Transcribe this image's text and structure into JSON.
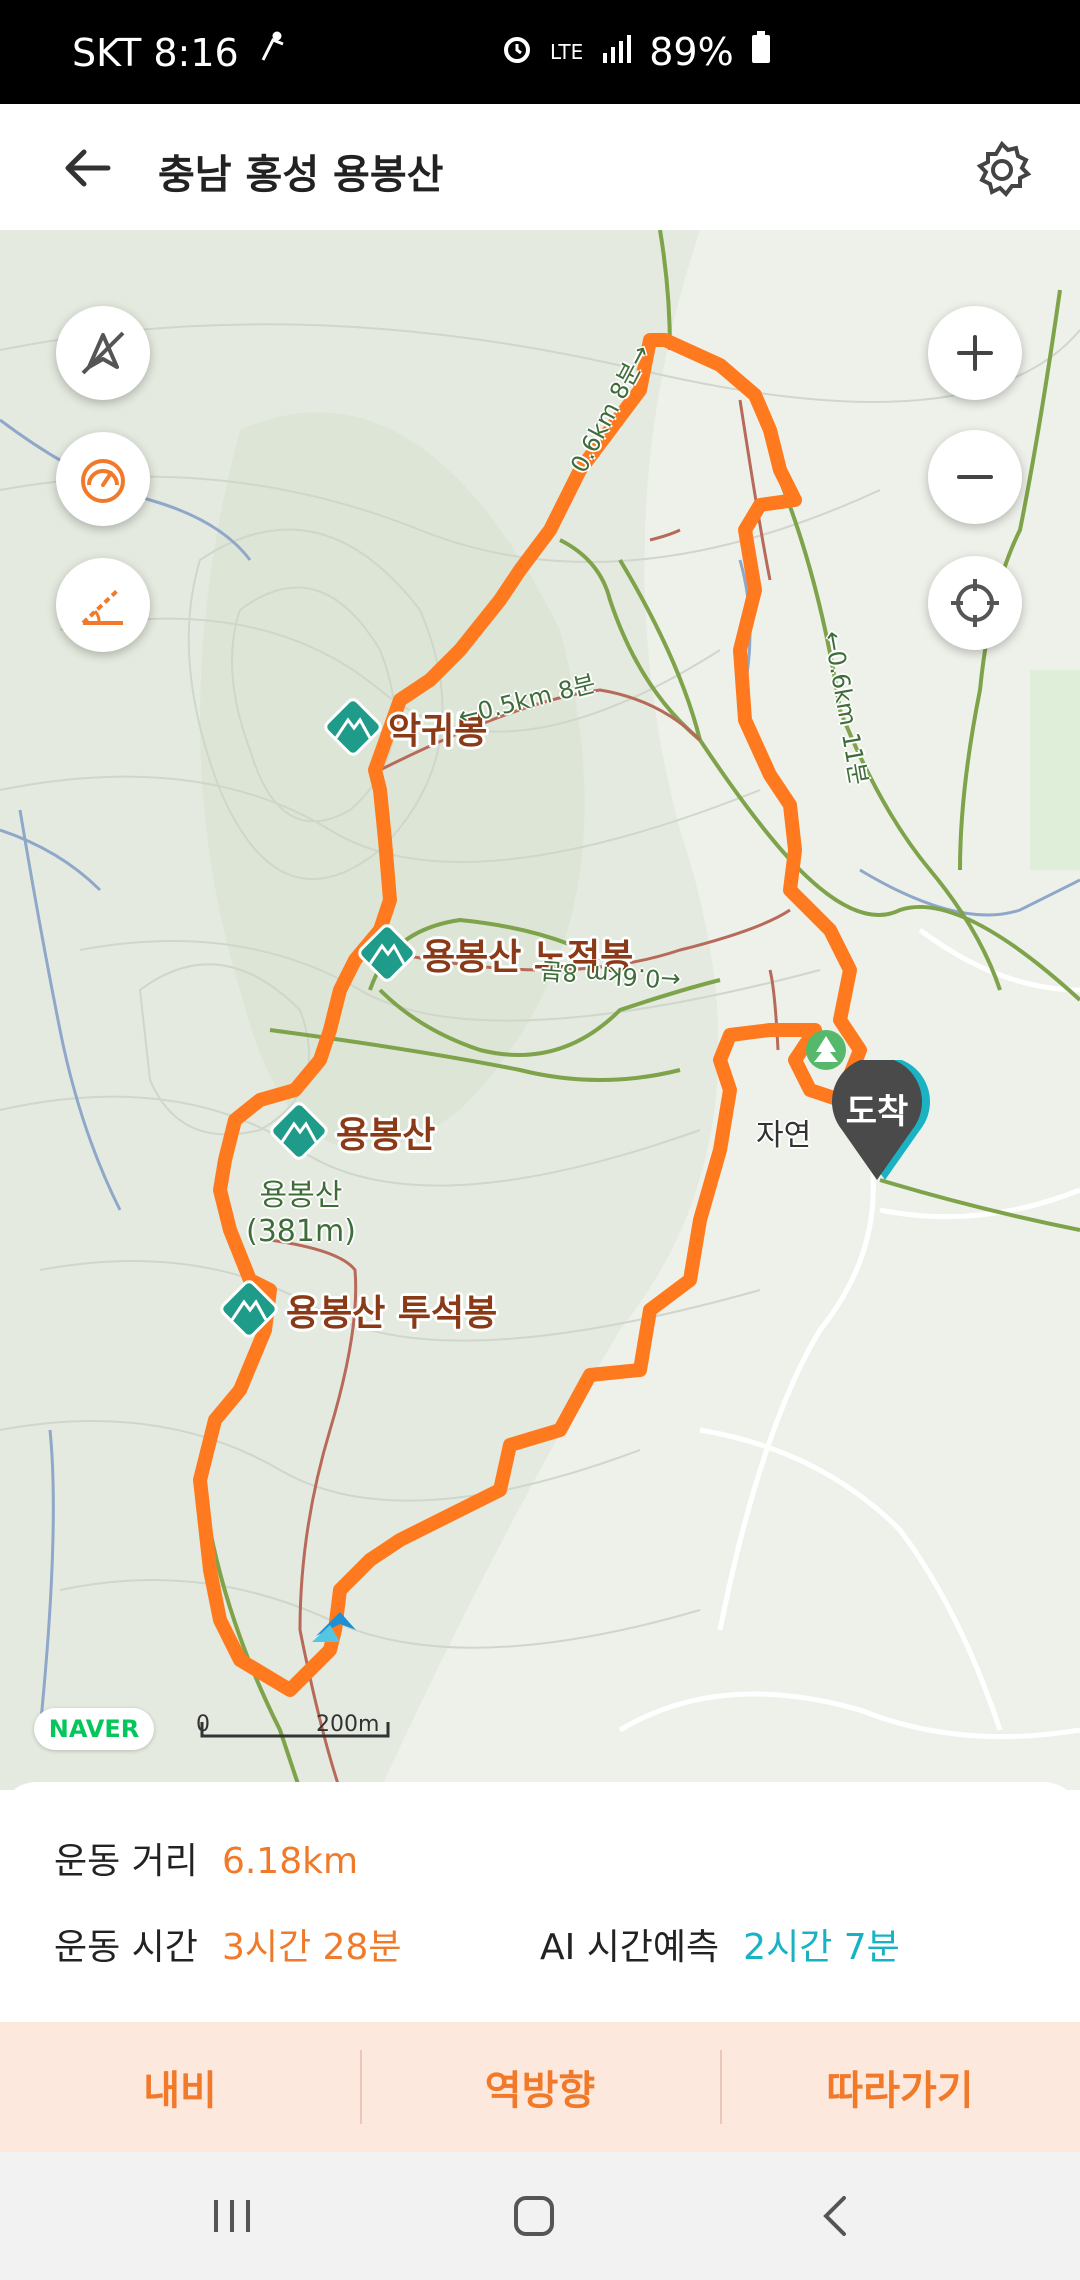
{
  "status": {
    "carrier_time": "SKT 8:16",
    "network": "LTE",
    "battery": "89%"
  },
  "header": {
    "title": "충남 홍성 용봉산"
  },
  "map": {
    "peaks": [
      {
        "name": "악귀봉"
      },
      {
        "name": "용봉산 노적봉"
      },
      {
        "name": "용봉산"
      },
      {
        "name": "용봉산 투석봉"
      }
    ],
    "peak_caption": "용봉산\n(381m)",
    "trail_notes": [
      "←0.5km 8분",
      "←0.6km 8분",
      "←0.6km 11분",
      "0.6km 8분→"
    ],
    "place_label": "자연",
    "end_marker": "도착",
    "naver": "NAVER",
    "scale_start": "0",
    "scale_end": "200m"
  },
  "stats": {
    "distance_label": "운동 거리",
    "distance_value": "6.18km",
    "time_label": "운동 시간",
    "time_value": "3시간 28분",
    "ai_label": "AI 시간예측",
    "ai_value": "2시간 7분"
  },
  "actions": {
    "nav": "내비",
    "reverse": "역방향",
    "follow": "따라가기"
  },
  "colors": {
    "accent": "#f07a2a",
    "teal": "#18b3c2",
    "peak": "#1f9b8a",
    "route": "#ff7a1f"
  }
}
